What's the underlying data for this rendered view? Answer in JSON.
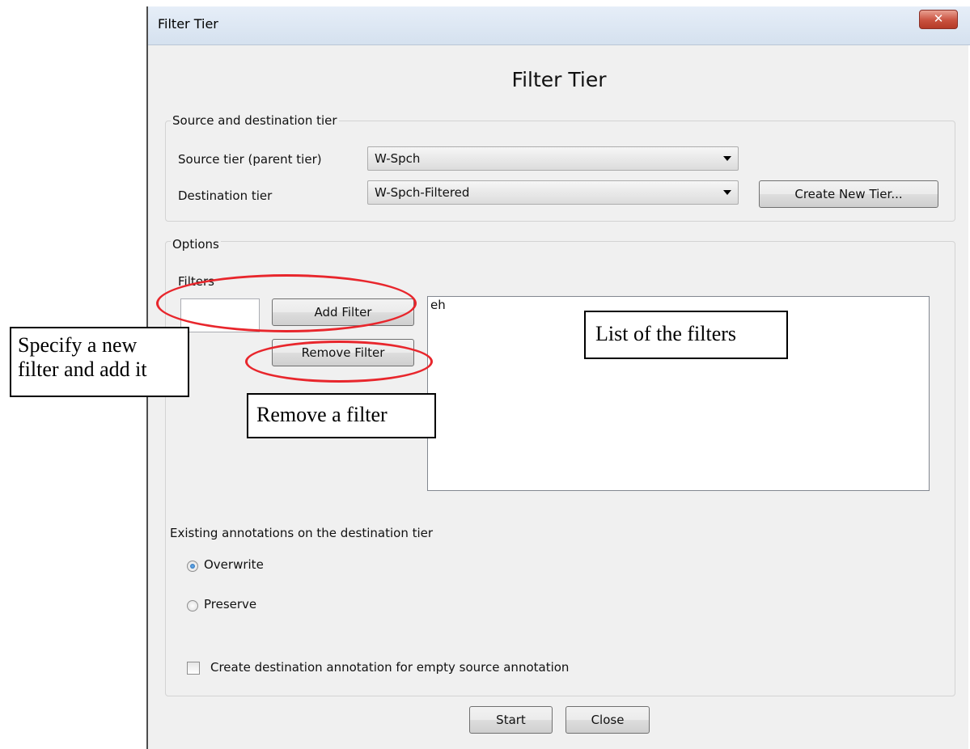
{
  "window": {
    "title": "Filter Tier",
    "close_glyph": "✕",
    "heading": "Filter Tier"
  },
  "source_group": {
    "label": "Source and destination tier",
    "source_label": "Source tier (parent tier)",
    "source_value": "W-Spch",
    "dest_label": "Destination tier",
    "dest_value": "W-Spch-Filtered",
    "create_button": "Create New Tier..."
  },
  "options_group": {
    "label": "Options",
    "filters_label": "Filters",
    "filter_input_value": "",
    "add_button": "Add Filter",
    "remove_button": "Remove Filter",
    "filters_list": [
      "eh"
    ],
    "existing_label": "Existing annotations on the destination tier",
    "overwrite_label": "Overwrite",
    "overwrite_checked": true,
    "preserve_label": "Preserve",
    "preserve_checked": false,
    "empty_source_label": "Create destination annotation for empty source annotation",
    "empty_source_checked": false
  },
  "footer": {
    "start_button": "Start",
    "close_button": "Close"
  },
  "annotations": {
    "specify_callout_line1": "Specify a new",
    "specify_callout_line2": "filter and add it",
    "list_callout": "List of the filters",
    "remove_callout": "Remove a filter",
    "ellipse_color": "#e8262c"
  }
}
